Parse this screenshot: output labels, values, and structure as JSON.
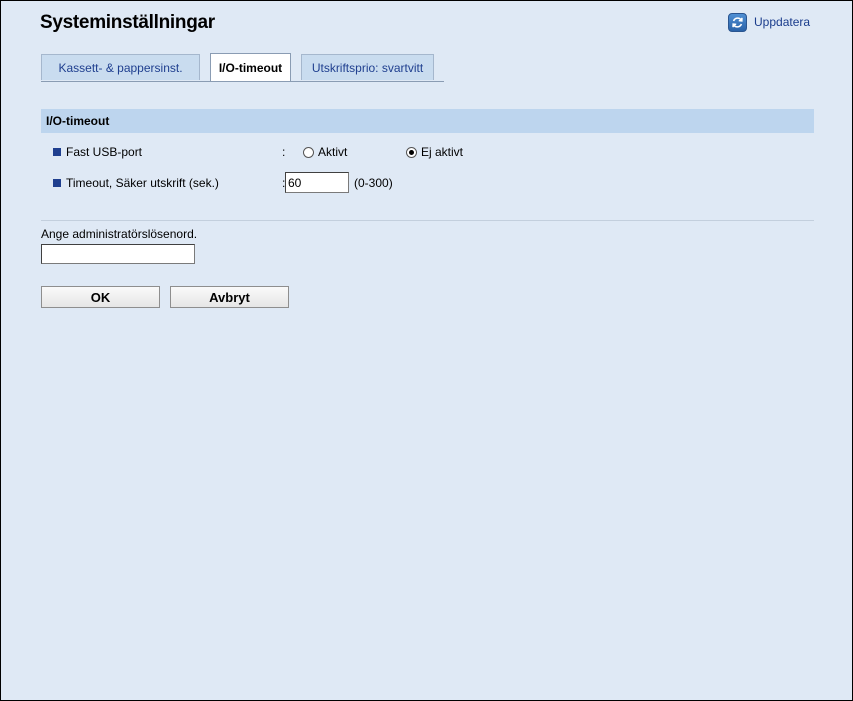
{
  "header": {
    "title": "Systeminställningar",
    "refresh_label": "Uppdatera"
  },
  "tabs": [
    {
      "label": "Kassett- & pappersinst.",
      "active": false
    },
    {
      "label": "I/O-timeout",
      "active": true
    },
    {
      "label": "Utskriftsprio: svartvitt",
      "active": false
    }
  ],
  "section": {
    "title": "I/O-timeout"
  },
  "settings": {
    "fast_usb": {
      "label": "Fast USB-port",
      "separator": ":",
      "options": [
        "Aktivt",
        "Ej aktivt"
      ],
      "selected": "Ej aktivt"
    },
    "timeout": {
      "label": "Timeout, Säker utskrift (sek.)",
      "separator": ":",
      "value": "60",
      "range_hint": "(0-300)"
    }
  },
  "password": {
    "label": "Ange administratörslösenord.",
    "value": ""
  },
  "buttons": {
    "ok_label": "OK",
    "cancel_label": "Avbryt"
  },
  "colors": {
    "background": "#dfe9f5",
    "section_header": "#bdd5ee",
    "tab_inactive": "#c9dcef",
    "link": "#1a3c8c",
    "bullet": "#1f3f8f"
  },
  "icons": {
    "refresh": "refresh-icon"
  }
}
